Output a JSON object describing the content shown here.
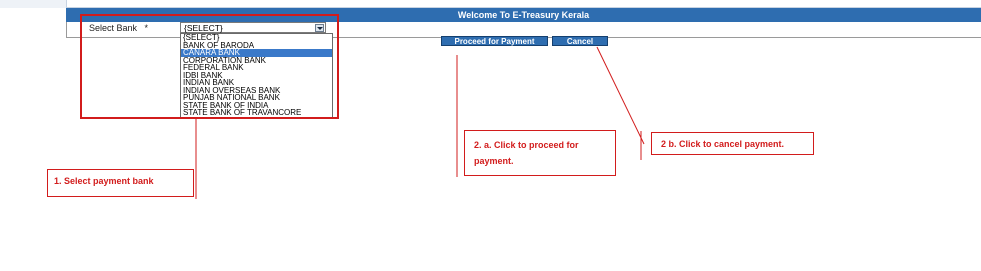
{
  "header": {
    "title": "Welcome To E-Treasury Kerala"
  },
  "form": {
    "select_bank_label": "Select Bank",
    "required_marker": "*",
    "selected_value": "{SELECT}",
    "options": [
      "{SELECT}",
      "BANK OF BARODA",
      "CANARA BANK",
      "CORPORATION BANK",
      "FEDERAL BANK",
      "IDBI BANK",
      "INDIAN BANK",
      "INDIAN OVERSEAS BANK",
      "PUNJAB NATIONAL BANK",
      "STATE BANK OF INDIA",
      "STATE BANK OF TRAVANCORE"
    ],
    "highlighted_option": "CANARA BANK"
  },
  "buttons": {
    "proceed": "Proceed for Payment",
    "cancel": "Cancel"
  },
  "annotations": {
    "step1": "1. Select payment bank",
    "step2a": "2. a. Click to proceed for payment.",
    "step2b": "2 b. Click to cancel payment."
  },
  "colors": {
    "header_bg": "#2e6db0",
    "annotation_red": "#d21c1c",
    "highlight": "#3a79c9"
  }
}
